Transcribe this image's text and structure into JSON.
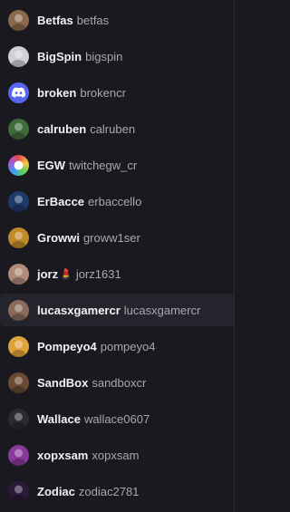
{
  "users": [
    {
      "display_name": "Betfas",
      "username": "betfas",
      "avatar_icon": "betfas-avatar",
      "avatar_color": "#8a6a4e"
    },
    {
      "display_name": "BigSpin",
      "username": "bigspin",
      "avatar_icon": "bigspin-avatar",
      "avatar_color": "#cfcfd4"
    },
    {
      "display_name": "broken",
      "username": "brokencr",
      "avatar_icon": "discord-avatar",
      "avatar_color": "#5865f2"
    },
    {
      "display_name": "calruben",
      "username": "calruben",
      "avatar_icon": "calruben-avatar",
      "avatar_color": "#3f6b3a"
    },
    {
      "display_name": "EGW",
      "username": "twitchegw_cr",
      "avatar_icon": "egw-avatar",
      "avatar_color": "#e8e23a"
    },
    {
      "display_name": "ErBacce",
      "username": "erbaccello",
      "avatar_icon": "erbacce-avatar",
      "avatar_color": "#1e3a6a"
    },
    {
      "display_name": "Growwi",
      "username": "groww1ser",
      "avatar_icon": "growwi-avatar",
      "avatar_color": "#c08a2c"
    },
    {
      "display_name": "jorz",
      "username": "jorz1631",
      "avatar_icon": "jorz-avatar",
      "avatar_color": "#b08a7a",
      "emoji": "💄"
    },
    {
      "display_name": "lucasxgamercr",
      "username": "lucasxgamercr",
      "avatar_icon": "lucas-avatar",
      "avatar_color": "#8a6a5a",
      "active": true
    },
    {
      "display_name": "Pompeyo4",
      "username": "pompeyo4",
      "avatar_icon": "pompeyo-avatar",
      "avatar_color": "#e0a23a"
    },
    {
      "display_name": "SandBox",
      "username": "sandboxcr",
      "avatar_icon": "sandbox-avatar",
      "avatar_color": "#6a4a32"
    },
    {
      "display_name": "Wallace",
      "username": "wallace0607",
      "avatar_icon": "wallace-avatar",
      "avatar_color": "#2a2a30"
    },
    {
      "display_name": "xopxsam",
      "username": "xopxsam",
      "avatar_icon": "xopxsam-avatar",
      "avatar_color": "#8a3a9a"
    },
    {
      "display_name": "Zodiac",
      "username": "zodiac2781",
      "avatar_icon": "zodiac-avatar",
      "avatar_color": "#2a1a3a"
    }
  ]
}
